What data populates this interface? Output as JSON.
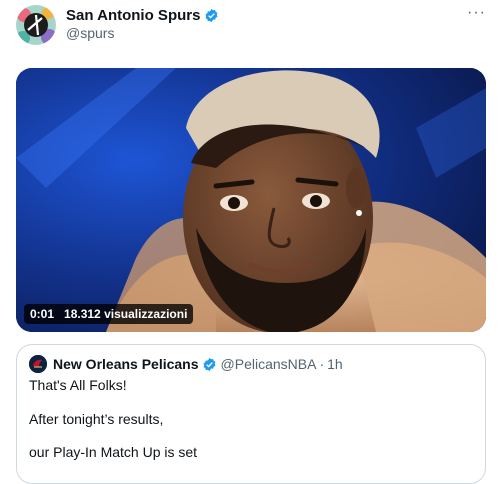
{
  "tweet": {
    "author_name": "San Antonio Spurs",
    "author_handle": "@spurs",
    "more_label": "···",
    "video": {
      "time": "0:01",
      "views": "18.312 visualizzazioni"
    }
  },
  "quote": {
    "author_name": "New Orleans Pelicans",
    "author_handle": "@PelicansNBA",
    "separator": "·",
    "time": "1h",
    "lines": [
      "That's All Folks!",
      "After tonight’s results,",
      "our Play-In Match Up is set"
    ]
  },
  "colors": {
    "verified": "#1d9bf0",
    "text_primary": "#0f1419",
    "text_secondary": "#536471",
    "border": "#cfd9de"
  }
}
